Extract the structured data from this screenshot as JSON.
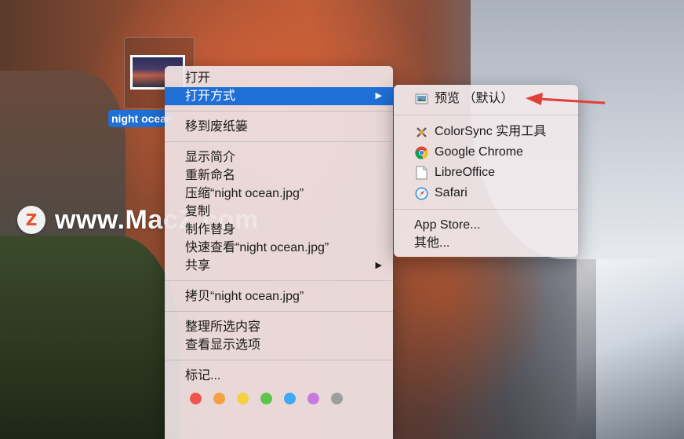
{
  "desktop": {
    "file_label": "night ocean.jpg"
  },
  "watermark": {
    "logo_letter": "Z",
    "text": "www.MacZ.com"
  },
  "context_menu": {
    "items": [
      {
        "label": "打开"
      },
      {
        "label": "打开方式",
        "active": true,
        "has_submenu": true
      },
      {
        "label": "移到废纸篓"
      },
      {
        "label": "显示简介"
      },
      {
        "label": "重新命名"
      },
      {
        "label": "压缩“night ocean.jpg”"
      },
      {
        "label": "复制"
      },
      {
        "label": "制作替身"
      },
      {
        "label": "快速查看“night ocean.jpg”"
      },
      {
        "label": "共享",
        "has_submenu": true
      },
      {
        "label": "拷贝“night ocean.jpg”"
      },
      {
        "label": "整理所选内容"
      },
      {
        "label": "查看显示选项"
      },
      {
        "label": "标记..."
      }
    ],
    "submenu_arrow": "▶",
    "tag_colors": [
      "#f0544f",
      "#f5a142",
      "#f5d142",
      "#5cc54a",
      "#3fa9f5",
      "#c77ae0",
      "#9e9e9e"
    ]
  },
  "open_with_submenu": {
    "items": [
      {
        "label": "预览 （默认）",
        "icon": "preview-icon"
      },
      {
        "label": "ColorSync 实用工具",
        "icon": "colorsync-icon"
      },
      {
        "label": "Google Chrome",
        "icon": "chrome-icon"
      },
      {
        "label": "LibreOffice",
        "icon": "libreoffice-icon"
      },
      {
        "label": "Safari",
        "icon": "safari-icon"
      },
      {
        "label": "App Store..."
      },
      {
        "label": "其他..."
      }
    ]
  },
  "annotation": {
    "color": "#e0403a"
  }
}
